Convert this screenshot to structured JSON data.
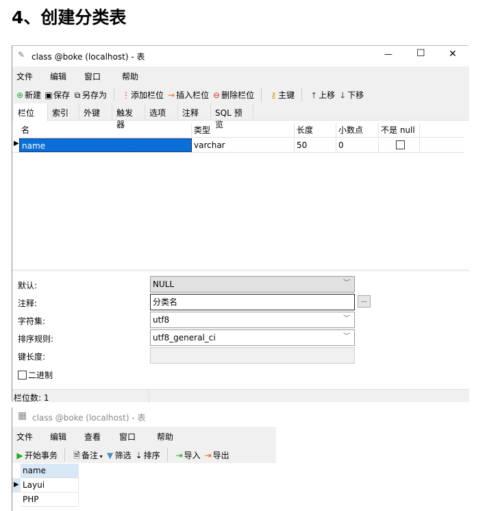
{
  "heading": "4、创建分类表",
  "window1": {
    "title": "class @boke (localhost) - 表",
    "controls": {
      "minimize": "—",
      "maximize": "☐",
      "close": "✕"
    },
    "menu": [
      "文件",
      "编辑",
      "窗口",
      "帮助"
    ],
    "toolbar": {
      "new": "新建",
      "save": "保存",
      "save_as": "另存为",
      "add_field": "添加栏位",
      "insert_field": "插入栏位",
      "delete_field": "删除栏位",
      "primary_key": "主键",
      "move_up": "上移",
      "move_down": "下移"
    },
    "tabs": [
      "栏位",
      "索引",
      "外键",
      "触发器",
      "选项",
      "注释",
      "SQL 预览"
    ],
    "grid": {
      "headers": [
        "名",
        "类型",
        "长度",
        "小数点",
        "不是 null"
      ],
      "rows": [
        {
          "name": "name",
          "type": "varchar",
          "length": "50",
          "decimals": "0",
          "not_null": false
        }
      ]
    },
    "form": {
      "default_label": "默认:",
      "default_value": "NULL",
      "comment_label": "注释:",
      "comment_value": "分类名",
      "more_button": "...",
      "charset_label": "字符集:",
      "charset_value": "utf8",
      "collation_label": "排序规则:",
      "collation_value": "utf8_general_ci",
      "key_length_label": "键长度:",
      "key_length_value": "",
      "binary_label": "二进制",
      "binary_checked": false
    },
    "status": "栏位数: 1"
  },
  "window2": {
    "title": "class @boke (localhost) - 表",
    "menu": [
      "文件",
      "编辑",
      "查看",
      "窗口",
      "帮助"
    ],
    "toolbar": {
      "begin_transaction": "开始事务",
      "memo": "备注",
      "filter": "筛选",
      "sort": "排序",
      "import": "导入",
      "export": "导出"
    },
    "grid": {
      "header": "name",
      "rows": [
        "Layui",
        "PHP"
      ]
    }
  }
}
